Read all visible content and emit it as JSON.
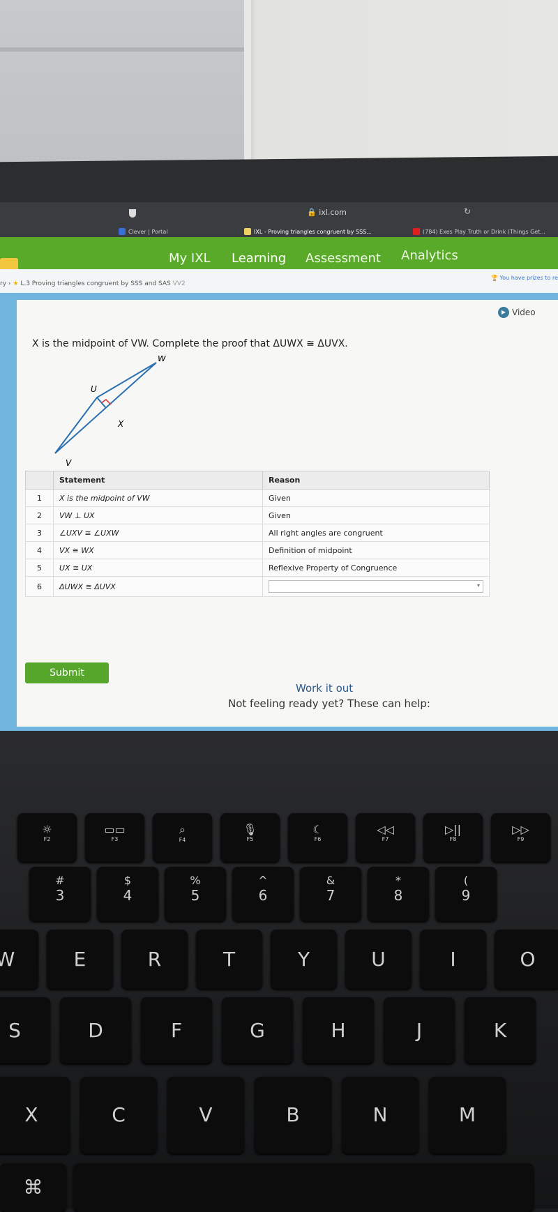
{
  "browser": {
    "url": "ixl.com",
    "tabs": [
      {
        "label": "Clever | Portal",
        "color": "#3a6fd8"
      },
      {
        "label": "IXL - Proving triangles congruent by SSS...",
        "color": "#f0d060"
      },
      {
        "label": "(784) Exes Play Truth or Drink (Things Get...",
        "color": "#e02020"
      }
    ]
  },
  "nav": {
    "items": [
      "My IXL",
      "Learning",
      "Assessment",
      "Analytics"
    ],
    "active": "Learning",
    "color": "#5aaa2a"
  },
  "breadcrumb": {
    "skill": "L.3 Proving triangles congruent by SSS and SAS",
    "code": "VV2",
    "prize": "You have prizes to re"
  },
  "video_label": "Video",
  "question": "X is the midpoint of VW. Complete the proof that ΔUWX ≅ ΔUVX.",
  "diagram": {
    "labels": [
      "W",
      "U",
      "X",
      "V"
    ]
  },
  "table": {
    "headers": [
      "Statement",
      "Reason"
    ],
    "rows": [
      {
        "n": "1",
        "statement": "X is the midpoint of VW",
        "reason": "Given"
      },
      {
        "n": "2",
        "statement": "VW ⊥ UX",
        "reason": "Given"
      },
      {
        "n": "3",
        "statement": "∠UXV ≅ ∠UXW",
        "reason": "All right angles are congruent"
      },
      {
        "n": "4",
        "statement": "VX ≅ WX",
        "reason": "Definition of midpoint"
      },
      {
        "n": "5",
        "statement": "UX ≅ UX",
        "reason": "Reflexive Property of Congruence"
      },
      {
        "n": "6",
        "statement": "ΔUWX ≅ ΔUVX",
        "reason": ""
      }
    ]
  },
  "submit_label": "Submit",
  "work_it_out": "Work it out",
  "not_ready": "Not feeling ready yet? These can help:",
  "keyboard": {
    "fn": [
      {
        "icon": "☼",
        "label": "F2"
      },
      {
        "icon": "▭▭",
        "label": "F3"
      },
      {
        "icon": "⌕",
        "label": "F4"
      },
      {
        "icon": "🎙",
        "label": "F5"
      },
      {
        "icon": "☾",
        "label": "F6"
      },
      {
        "icon": "◁◁",
        "label": "F7"
      },
      {
        "icon": "▷||",
        "label": "F8"
      },
      {
        "icon": "▷▷",
        "label": "F9"
      }
    ],
    "num": [
      {
        "sym": "#",
        "key": "3"
      },
      {
        "sym": "$",
        "key": "4"
      },
      {
        "sym": "%",
        "key": "5"
      },
      {
        "sym": "^",
        "key": "6"
      },
      {
        "sym": "&",
        "key": "7"
      },
      {
        "sym": "*",
        "key": "8"
      },
      {
        "sym": "(",
        "key": "9"
      }
    ],
    "row1": [
      "W",
      "E",
      "R",
      "T",
      "Y",
      "U",
      "I",
      "O"
    ],
    "row2": [
      "S",
      "D",
      "F",
      "G",
      "H",
      "J",
      "K"
    ],
    "row3": [
      "X",
      "C",
      "V",
      "B",
      "N",
      "M"
    ],
    "cmd": "⌘"
  }
}
